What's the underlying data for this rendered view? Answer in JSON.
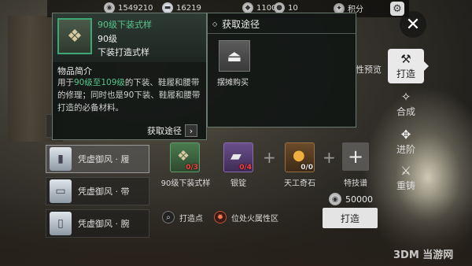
{
  "currency": {
    "gold": "1549210",
    "silver": "16219",
    "bag": "11000",
    "ten": "10",
    "points_label": "积分"
  },
  "tooltip": {
    "item_name": "90级下装式样",
    "level": "90级",
    "type": "下装打造式样",
    "section_title": "物品简介",
    "desc_prefix": "用于",
    "desc_highlight": "90级至109级",
    "desc_rest": "的下装、鞋履和腰带的修理；同时也是90下装、鞋履和腰带打造的必备材料。",
    "get_label": "获取途径"
  },
  "acquire": {
    "title": "获取途径",
    "option_label": "摆摊购买"
  },
  "preview_label": "性预览",
  "sidenav": {
    "items": [
      {
        "label": "打造",
        "icon": "anvil-icon"
      },
      {
        "label": "合成",
        "icon": "synthesis-icon"
      },
      {
        "label": "进阶",
        "icon": "upgrade-icon"
      },
      {
        "label": "重铸",
        "icon": "hammer-icon"
      }
    ]
  },
  "list": {
    "items": [
      {
        "label": "凭虚御风 · 履"
      },
      {
        "label": "凭虚御风 · 带"
      },
      {
        "label": "凭虚御风 · 腕"
      }
    ]
  },
  "materials": [
    {
      "label": "90级下装式样",
      "count": "0/3"
    },
    {
      "label": "银锭",
      "count": "0/4"
    },
    {
      "label": "天工奇石",
      "count": "0/0"
    },
    {
      "label": "特技谱",
      "count": ""
    }
  ],
  "cost": "50000",
  "forge_button": "打造",
  "bottom_links": {
    "forge_point": "打造点",
    "fire_attr": "位处火属性区"
  },
  "watermark": "3DM 当游网"
}
